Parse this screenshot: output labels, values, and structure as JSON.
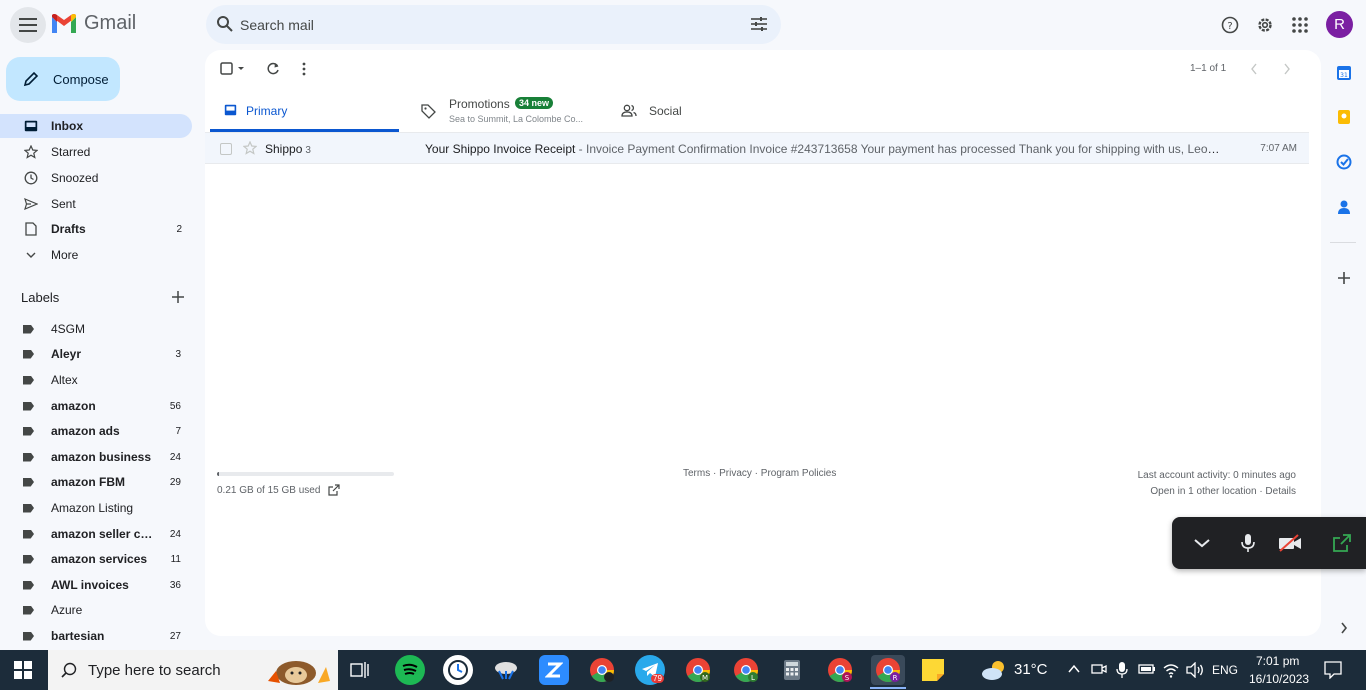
{
  "header": {
    "logo_text": "Gmail",
    "search_placeholder": "Search mail",
    "avatar_letter": "R"
  },
  "sidebar": {
    "compose_label": "Compose",
    "nav": [
      {
        "label": "Inbox",
        "count": ""
      },
      {
        "label": "Starred",
        "count": ""
      },
      {
        "label": "Snoozed",
        "count": ""
      },
      {
        "label": "Sent",
        "count": ""
      },
      {
        "label": "Drafts",
        "count": "2"
      },
      {
        "label": "More",
        "count": ""
      }
    ],
    "labels_title": "Labels",
    "labels": [
      {
        "label": "4SGM",
        "count": ""
      },
      {
        "label": "Aleyr",
        "count": "3"
      },
      {
        "label": "Altex",
        "count": ""
      },
      {
        "label": "amazon",
        "count": "56"
      },
      {
        "label": "amazon ads",
        "count": "7"
      },
      {
        "label": "amazon business",
        "count": "24"
      },
      {
        "label": "amazon FBM",
        "count": "29"
      },
      {
        "label": "Amazon Listing",
        "count": ""
      },
      {
        "label": "amazon seller cen...",
        "count": "24"
      },
      {
        "label": "amazon services",
        "count": "11"
      },
      {
        "label": "AWL invoices",
        "count": "36"
      },
      {
        "label": "Azure",
        "count": ""
      },
      {
        "label": "bartesian",
        "count": "27"
      }
    ]
  },
  "toolbar": {
    "pager_text": "1–1 of 1"
  },
  "tabs": {
    "primary": "Primary",
    "promotions": "Promotions",
    "promotions_badge": "34 new",
    "promotions_sub": "Sea to Summit, La Colombe Co...",
    "social": "Social"
  },
  "emails": [
    {
      "sender": "Shippo",
      "count": "3",
      "subject": "Your Shippo Invoice Receipt",
      "snippet": " - Invoice Payment Confirmation Invoice #243713658 Your payment has processed Thank you for shipping with us, Leon! This is ...",
      "time": "7:07 AM"
    }
  ],
  "footer": {
    "storage": "0.21 GB of 15 GB used",
    "storage_fraction": 0.014,
    "links": "Terms · Privacy · Program Policies",
    "activity_line1": "Last account activity: 0 minutes ago",
    "activity_line2": "Open in 1 other location · Details"
  },
  "taskbar": {
    "search_text": "Type here to search",
    "weather": "31°C",
    "lang": "ENG",
    "time": "7:01 pm",
    "date": "16/10/2023",
    "telegram_badge": "79"
  },
  "colors": {
    "accent": "#0b57d0",
    "compose_bg": "#c2e7ff",
    "active_nav": "#d3e3fd",
    "badge_green": "#188038"
  }
}
